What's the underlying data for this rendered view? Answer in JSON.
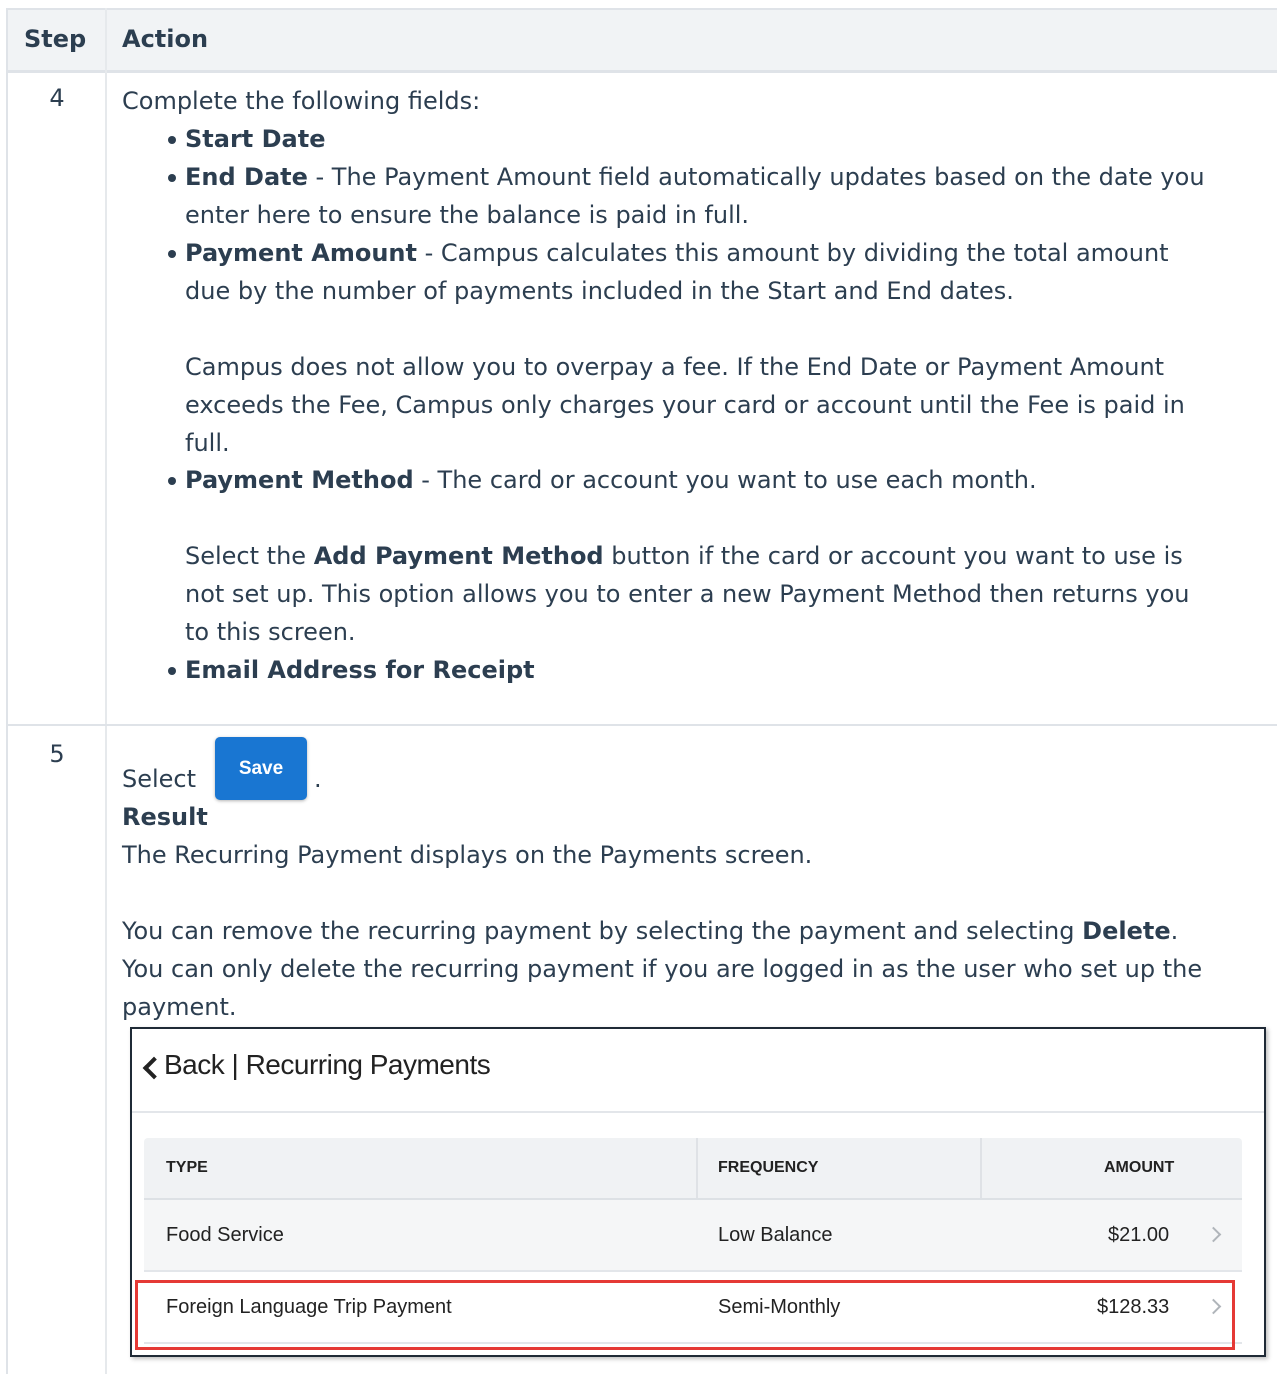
{
  "header": {
    "step": "Step",
    "action": "Action"
  },
  "step4": {
    "number": "4",
    "intro": "Complete the following fields:",
    "start_date": "Start Date",
    "end_date_label": "End Date",
    "end_date_line1": " - The Payment Amount field automatically updates based on the date you",
    "end_date_line2": "enter here to ensure the balance is paid in full.",
    "payment_amount_label": "Payment Amount",
    "payment_amount_line1": " - Campus calculates this amount by dividing the total amount",
    "payment_amount_line2": "due by the number of payments included in the Start and End dates.",
    "overpay_line1": "Campus does not allow you to overpay a fee. If the End Date or Payment Amount",
    "overpay_line2": "exceeds the Fee, Campus only charges your card or account until the Fee is paid in",
    "overpay_line3": "full.",
    "payment_method_label": "Payment Method",
    "payment_method_text": " - The card or account you want to use each month.",
    "add_pm_pre": "Select the ",
    "add_pm_bold": "Add Payment Method",
    "add_pm_post": " button if the card or account you want to use is",
    "add_pm_line2": "not set up. This option allows you to enter a new Payment Method then returns you",
    "add_pm_line3": "to this screen.",
    "email_label": "Email Address for Receipt"
  },
  "step5": {
    "number": "5",
    "select": "Select",
    "save_button": "Save",
    "period": ".",
    "result_label": "Result",
    "result_text": "The Recurring Payment displays on the Payments screen.",
    "delete_pre": "You can remove the recurring payment by selecting the payment and selecting ",
    "delete_bold": "Delete",
    "delete_post": ".",
    "delete_line2": "You can only delete the recurring payment if you are logged in as the user who set up the",
    "delete_line3": "payment."
  },
  "screenshot": {
    "title": "Back | Recurring Payments",
    "columns": [
      "TYPE",
      "FREQUENCY",
      "AMOUNT"
    ],
    "rows": [
      {
        "type": "Food Service",
        "frequency": "Low Balance",
        "amount": "$21.00"
      },
      {
        "type": "Foreign Language Trip Payment",
        "frequency": "Semi-Monthly",
        "amount": "$128.33"
      }
    ],
    "highlight_color": "#e53935"
  }
}
